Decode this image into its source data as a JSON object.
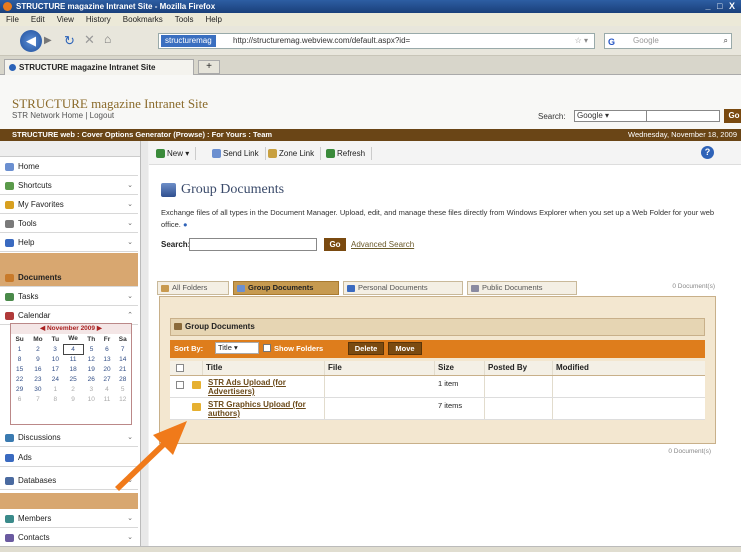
{
  "browser": {
    "window_title": "STRUCTURE magazine Intranet Site - Mozilla Firefox",
    "window_controls": "_ □ X",
    "menu": [
      "File",
      "Edit",
      "View",
      "History",
      "Bookmarks",
      "Tools",
      "Help"
    ],
    "url_site_label": "structuremag",
    "url": "http://structuremag.webview.com/default.aspx?id=",
    "search_placeholder": "Google",
    "tab_title": "STRUCTURE magazine Intranet Site",
    "new_tab_symbol": "+"
  },
  "site": {
    "title": "STRUCTURE magazine Intranet Site",
    "subtitle": "STR Network Home | Logout",
    "search_label": "Search:",
    "search_scope": "Google",
    "search_go": "Go",
    "nav_path": "STRUCTURE web : Cover Options Generator (Prowse) : For Yours : Team",
    "date": "Wednesday, November 18, 2009"
  },
  "sidebar": {
    "items": [
      {
        "label": "Home",
        "icon": "home-icon",
        "color": "#6b8fd0"
      },
      {
        "label": "Shortcuts",
        "icon": "shortcuts-icon",
        "color": "#5a9a4a"
      },
      {
        "label": "My Favorites",
        "icon": "favorites-icon",
        "color": "#d8a020"
      },
      {
        "label": "Tools",
        "icon": "tools-icon",
        "color": "#7a7a7a"
      },
      {
        "label": "Help",
        "icon": "help-icon",
        "color": "#3a6ac0"
      },
      {
        "label": "Documents",
        "icon": "documents-icon",
        "color": "#c87a2a"
      },
      {
        "label": "Tasks",
        "icon": "tasks-icon",
        "color": "#4a8a4a"
      },
      {
        "label": "Calendar",
        "icon": "calendar-icon",
        "color": "#b03a3a"
      },
      {
        "label": "Discussions",
        "icon": "discussions-icon",
        "color": "#3a7ab0"
      },
      {
        "label": "Ads",
        "icon": "ads-icon",
        "color": "#3a6ac0"
      },
      {
        "label": "Databases",
        "icon": "databases-icon",
        "color": "#4a6aa0"
      },
      {
        "label": "Members",
        "icon": "members-icon",
        "color": "#3a8a8a"
      },
      {
        "label": "Contacts",
        "icon": "contacts-icon",
        "color": "#6a5aa0"
      }
    ],
    "calendar": {
      "month": "November 2009",
      "dow": [
        "Su",
        "Mo",
        "Tu",
        "We",
        "Th",
        "Fr",
        "Sa"
      ],
      "weeks": [
        [
          "1",
          "2",
          "3",
          "4",
          "5",
          "6",
          "7"
        ],
        [
          "8",
          "9",
          "10",
          "11",
          "12",
          "13",
          "14"
        ],
        [
          "15",
          "16",
          "17",
          "18",
          "19",
          "20",
          "21"
        ],
        [
          "22",
          "23",
          "24",
          "25",
          "26",
          "27",
          "28"
        ],
        [
          "29",
          "30",
          "1",
          "2",
          "3",
          "4",
          "5"
        ],
        [
          "6",
          "7",
          "8",
          "9",
          "10",
          "11",
          "12"
        ]
      ],
      "today": "4"
    }
  },
  "toolbar": {
    "new": "New",
    "send_link": "Send Link",
    "zone_link": "Zone Link",
    "refresh": "Refresh",
    "help": "?"
  },
  "page": {
    "title": "Group Documents",
    "description": "Exchange files of all types in the Document Manager. Upload, edit, and manage these files directly from Windows Explorer when you set up a Web Folder for your web office.",
    "search_label": "Search:",
    "search_go": "Go",
    "advanced_search": "Advanced Search",
    "tabs": [
      {
        "label": "All Folders",
        "active": false,
        "color": "#c89a50"
      },
      {
        "label": "Group Documents",
        "active": true,
        "color": "#6b8fd0"
      },
      {
        "label": "Personal Documents",
        "active": false,
        "color": "#3a6ac0"
      },
      {
        "label": "Public Documents",
        "active": false,
        "color": "#8a8aa0"
      }
    ],
    "tabs_meta": "0 Document(s)",
    "panel_title": "Group Documents",
    "sort_label": "Sort By:",
    "sort_value": "Title",
    "show_folders": "Show Folders",
    "delete_btn": "Delete",
    "move_btn": "Move",
    "columns": [
      "Title",
      "File",
      "Size",
      "Posted By",
      "Modified"
    ],
    "rows": [
      {
        "title": "STR Ads Upload (for Advertisers)",
        "size": "1 item"
      },
      {
        "title": "STR Graphics Upload (for authors)",
        "size": "7 items"
      }
    ],
    "footer": "0 Document(s)"
  },
  "colors": {
    "accent_brown": "#6a4516",
    "accent_orange": "#de7d1c",
    "arrow": "#f07a1a"
  }
}
